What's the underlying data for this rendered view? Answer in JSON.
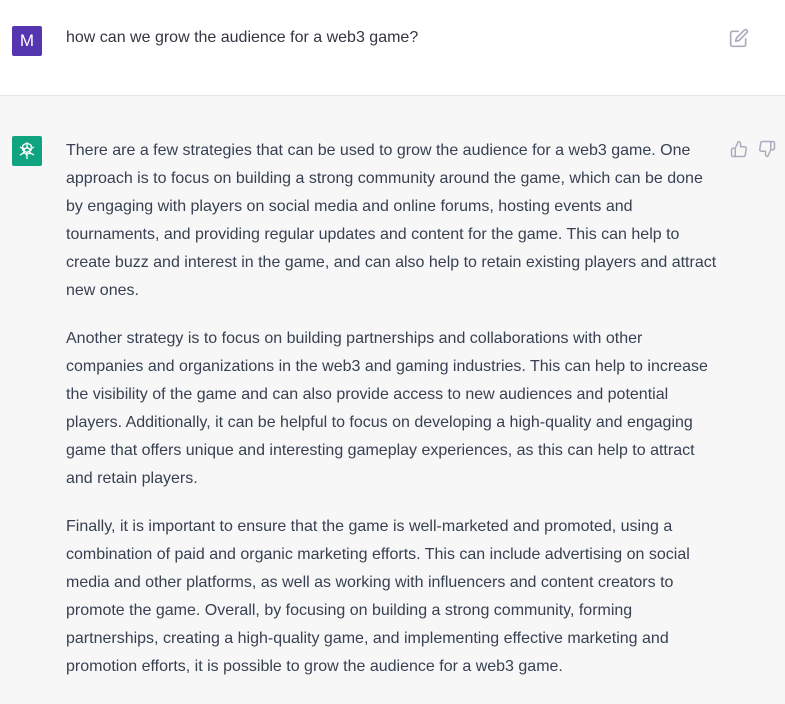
{
  "user": {
    "avatar_letter": "M",
    "avatar_color": "#5436b0",
    "message": "how can we grow the audience for a web3 game?",
    "edit_icon": "edit-icon"
  },
  "assistant": {
    "avatar_color": "#10a37f",
    "avatar_icon": "openai-logo-icon",
    "paragraphs": [
      "There are a few strategies that can be used to grow the audience for a web3 game. One approach is to focus on building a strong community around the game, which can be done by engaging with players on social media and online forums, hosting events and tournaments, and providing regular updates and content for the game. This can help to create buzz and interest in the game, and can also help to retain existing players and attract new ones.",
      "Another strategy is to focus on building partnerships and collaborations with other companies and organizations in the web3 and gaming industries. This can help to increase the visibility of the game and can also provide access to new audiences and potential players. Additionally, it can be helpful to focus on developing a high-quality and engaging game that offers unique and interesting gameplay experiences, as this can help to attract and retain players.",
      "Finally, it is important to ensure that the game is well-marketed and promoted, using a combination of paid and organic marketing efforts. This can include advertising on social media and other platforms, as well as working with influencers and content creators to promote the game. Overall, by focusing on building a strong community, forming partnerships, creating a high-quality game, and implementing effective marketing and promotion efforts, it is possible to grow the audience for a web3 game."
    ],
    "feedback_icons": [
      "thumbs-up-icon",
      "thumbs-down-icon"
    ]
  }
}
